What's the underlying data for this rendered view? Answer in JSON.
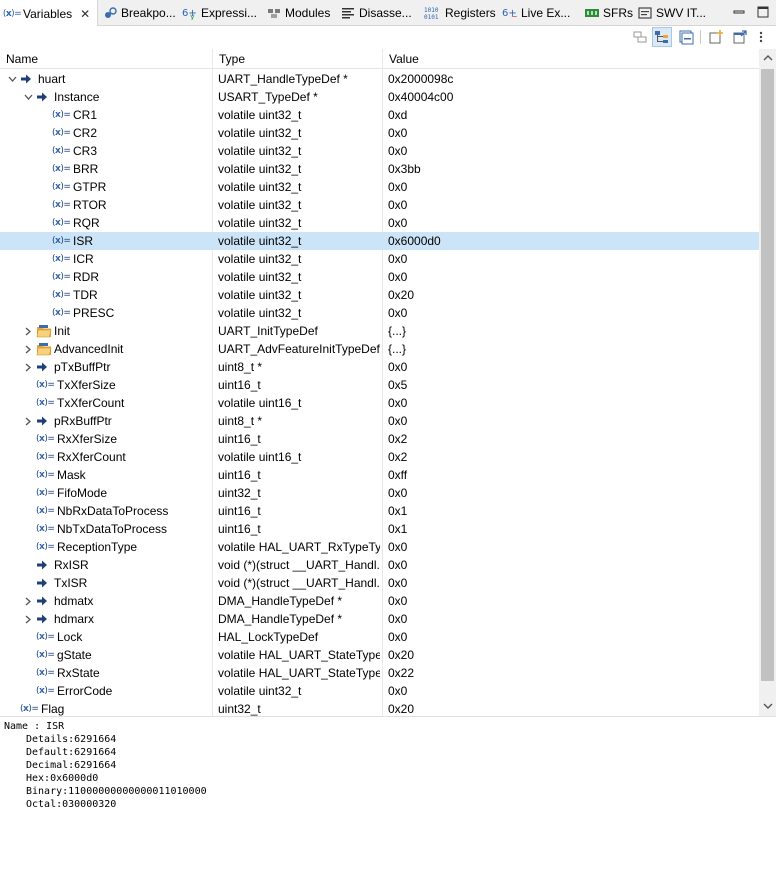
{
  "tabs": [
    {
      "label": "Variables",
      "icon": "variables-icon",
      "close": "✕"
    },
    {
      "label": "Breakpo...",
      "icon": "breakpoints-icon"
    },
    {
      "label": "Expressi...",
      "icon": "expressions-icon"
    },
    {
      "label": "Modules",
      "icon": "modules-icon"
    },
    {
      "label": "Disasse...",
      "icon": "disassembly-icon"
    },
    {
      "label": "Registers",
      "icon": "registers-icon"
    },
    {
      "label": "Live Ex...",
      "icon": "live-expressions-icon"
    },
    {
      "label": "SFRs",
      "icon": "sfrs-icon"
    },
    {
      "label": "SWV IT...",
      "icon": "swv-itm-icon"
    }
  ],
  "columns": {
    "name": "Name",
    "type": "Type",
    "value": "Value"
  },
  "rows": [
    {
      "name": "huart",
      "type": "UART_HandleTypeDef *",
      "value": "0x2000098c",
      "level": 0,
      "expander": "open",
      "icon": "pointer"
    },
    {
      "name": "Instance",
      "type": "USART_TypeDef *",
      "value": "0x40004c00",
      "level": 1,
      "expander": "open",
      "icon": "pointer"
    },
    {
      "name": "CR1",
      "type": "volatile uint32_t",
      "value": "0xd",
      "level": 2,
      "expander": "none",
      "icon": "var"
    },
    {
      "name": "CR2",
      "type": "volatile uint32_t",
      "value": "0x0",
      "level": 2,
      "expander": "none",
      "icon": "var"
    },
    {
      "name": "CR3",
      "type": "volatile uint32_t",
      "value": "0x0",
      "level": 2,
      "expander": "none",
      "icon": "var"
    },
    {
      "name": "BRR",
      "type": "volatile uint32_t",
      "value": "0x3bb",
      "level": 2,
      "expander": "none",
      "icon": "var"
    },
    {
      "name": "GTPR",
      "type": "volatile uint32_t",
      "value": "0x0",
      "level": 2,
      "expander": "none",
      "icon": "var"
    },
    {
      "name": "RTOR",
      "type": "volatile uint32_t",
      "value": "0x0",
      "level": 2,
      "expander": "none",
      "icon": "var"
    },
    {
      "name": "RQR",
      "type": "volatile uint32_t",
      "value": "0x0",
      "level": 2,
      "expander": "none",
      "icon": "var"
    },
    {
      "name": "ISR",
      "type": "volatile uint32_t",
      "value": "0x6000d0",
      "level": 2,
      "expander": "none",
      "icon": "var",
      "selected": true
    },
    {
      "name": "ICR",
      "type": "volatile uint32_t",
      "value": "0x0",
      "level": 2,
      "expander": "none",
      "icon": "var"
    },
    {
      "name": "RDR",
      "type": "volatile uint32_t",
      "value": "0x0",
      "level": 2,
      "expander": "none",
      "icon": "var"
    },
    {
      "name": "TDR",
      "type": "volatile uint32_t",
      "value": "0x20",
      "level": 2,
      "expander": "none",
      "icon": "var"
    },
    {
      "name": "PRESC",
      "type": "volatile uint32_t",
      "value": "0x0",
      "level": 2,
      "expander": "none",
      "icon": "var"
    },
    {
      "name": "Init",
      "type": "UART_InitTypeDef",
      "value": "{...}",
      "level": 1,
      "expander": "closed",
      "icon": "struct"
    },
    {
      "name": "AdvancedInit",
      "type": "UART_AdvFeatureInitTypeDef",
      "value": "{...}",
      "level": 1,
      "expander": "closed",
      "icon": "struct"
    },
    {
      "name": "pTxBuffPtr",
      "type": "uint8_t *",
      "value": "0x0",
      "level": 1,
      "expander": "closed",
      "icon": "pointer"
    },
    {
      "name": "TxXferSize",
      "type": "uint16_t",
      "value": "0x5",
      "level": 1,
      "expander": "none",
      "icon": "var"
    },
    {
      "name": "TxXferCount",
      "type": "volatile uint16_t",
      "value": "0x0",
      "level": 1,
      "expander": "none",
      "icon": "var"
    },
    {
      "name": "pRxBuffPtr",
      "type": "uint8_t *",
      "value": "0x0",
      "level": 1,
      "expander": "closed",
      "icon": "pointer"
    },
    {
      "name": "RxXferSize",
      "type": "uint16_t",
      "value": "0x2",
      "level": 1,
      "expander": "none",
      "icon": "var"
    },
    {
      "name": "RxXferCount",
      "type": "volatile uint16_t",
      "value": "0x2",
      "level": 1,
      "expander": "none",
      "icon": "var"
    },
    {
      "name": "Mask",
      "type": "uint16_t",
      "value": "0xff",
      "level": 1,
      "expander": "none",
      "icon": "var"
    },
    {
      "name": "FifoMode",
      "type": "uint32_t",
      "value": "0x0",
      "level": 1,
      "expander": "none",
      "icon": "var"
    },
    {
      "name": "NbRxDataToProcess",
      "type": "uint16_t",
      "value": "0x1",
      "level": 1,
      "expander": "none",
      "icon": "var"
    },
    {
      "name": "NbTxDataToProcess",
      "type": "uint16_t",
      "value": "0x1",
      "level": 1,
      "expander": "none",
      "icon": "var"
    },
    {
      "name": "ReceptionType",
      "type": "volatile HAL_UART_RxTypeTy...",
      "value": "0x0",
      "level": 1,
      "expander": "none",
      "icon": "var"
    },
    {
      "name": "RxISR",
      "type": "void (*)(struct __UART_Handl...",
      "value": "0x0",
      "level": 1,
      "expander": "none",
      "icon": "pointer"
    },
    {
      "name": "TxISR",
      "type": "void (*)(struct __UART_Handl...",
      "value": "0x0",
      "level": 1,
      "expander": "none",
      "icon": "pointer"
    },
    {
      "name": "hdmatx",
      "type": "DMA_HandleTypeDef *",
      "value": "0x0",
      "level": 1,
      "expander": "closed",
      "icon": "pointer"
    },
    {
      "name": "hdmarx",
      "type": "DMA_HandleTypeDef *",
      "value": "0x0",
      "level": 1,
      "expander": "closed",
      "icon": "pointer"
    },
    {
      "name": "Lock",
      "type": "HAL_LockTypeDef",
      "value": "0x0",
      "level": 1,
      "expander": "none",
      "icon": "var"
    },
    {
      "name": "gState",
      "type": "volatile HAL_UART_StateType...",
      "value": "0x20",
      "level": 1,
      "expander": "none",
      "icon": "var"
    },
    {
      "name": "RxState",
      "type": "volatile HAL_UART_StateType...",
      "value": "0x22",
      "level": 1,
      "expander": "none",
      "icon": "var"
    },
    {
      "name": "ErrorCode",
      "type": "volatile uint32_t",
      "value": "0x0",
      "level": 1,
      "expander": "none",
      "icon": "var"
    },
    {
      "name": "Flag",
      "type": "uint32_t",
      "value": "0x20",
      "level": 0,
      "expander": "none",
      "icon": "var"
    }
  ],
  "details": {
    "name_line": "Name : ISR",
    "lines": [
      "Details:6291664",
      "Default:6291664",
      "Decimal:6291664",
      "Hex:0x6000d0",
      "Binary:11000000000000011010000",
      "Octal:030000320"
    ]
  },
  "colors": {
    "selection": "#cce4f7",
    "pointer_arrow": "#1f3f7a",
    "struct_folder": "#e8a53a",
    "var_icon": "#2b64b3"
  }
}
